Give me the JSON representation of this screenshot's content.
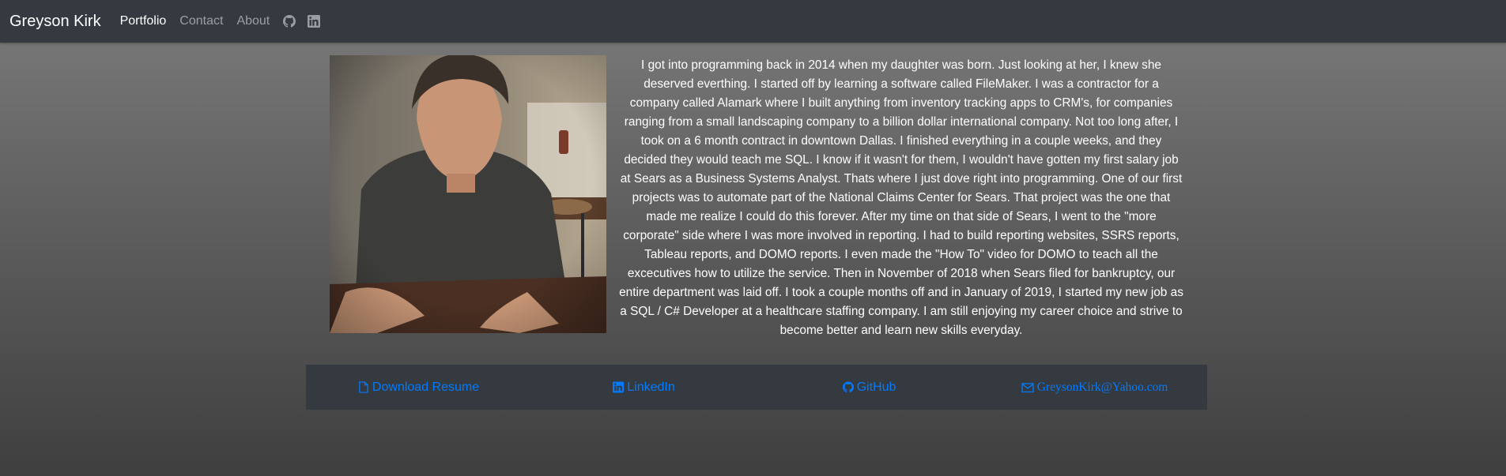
{
  "navbar": {
    "brand": "Greyson Kirk",
    "links": [
      "Portfolio",
      "Contact",
      "About"
    ],
    "icons": [
      "github-icon",
      "linkedin-icon"
    ]
  },
  "profile": {
    "photo_alt": "Greyson Kirk",
    "bio": "I got into programming back in 2014 when my daughter was born. Just looking at her, I knew she deserved everthing. I started off by learning a software called FileMaker. I was a contractor for a company called Alamark where I built anything from inventory tracking apps to CRM's, for companies ranging from a small landscaping company to a billion dollar international company. Not too long after, I took on a 6 month contract in downtown Dallas. I finished everything in a couple weeks, and they decided they would teach me SQL. I know if it wasn't for them, I wouldn't have gotten my first salary job at Sears as a Business Systems Analyst. Thats where I just dove right into programming. One of our first projects was to automate part of the National Claims Center for Sears. That project was the one that made me realize I could do this forever. After my time on that side of Sears, I went to the \"more corporate\" side where I was more involved in reporting. I had to build reporting websites, SSRS reports, Tableau reports, and DOMO reports. I even made the \"How To\" video for DOMO to teach all the excecutives how to utilize the service. Then in November of 2018 when Sears filed for bankruptcy, our entire department was laid off. I took a couple months off and in January of 2019, I started my new job as a SQL / C# Developer at a healthcare staffing company. I am still enjoying my career choice and strive to become better and learn new skills everyday."
  },
  "footer": {
    "links": [
      {
        "label": "Download Resume",
        "icon": "file-icon"
      },
      {
        "label": "LinkedIn",
        "icon": "linkedin-icon"
      },
      {
        "label": "GitHub",
        "icon": "github-icon"
      },
      {
        "label": "GreysonKirk@Yahoo.com",
        "icon": "envelope-icon"
      }
    ]
  },
  "colors": {
    "navbar_bg": "#343a40",
    "link": "#007bff",
    "text": "#ffffff"
  }
}
